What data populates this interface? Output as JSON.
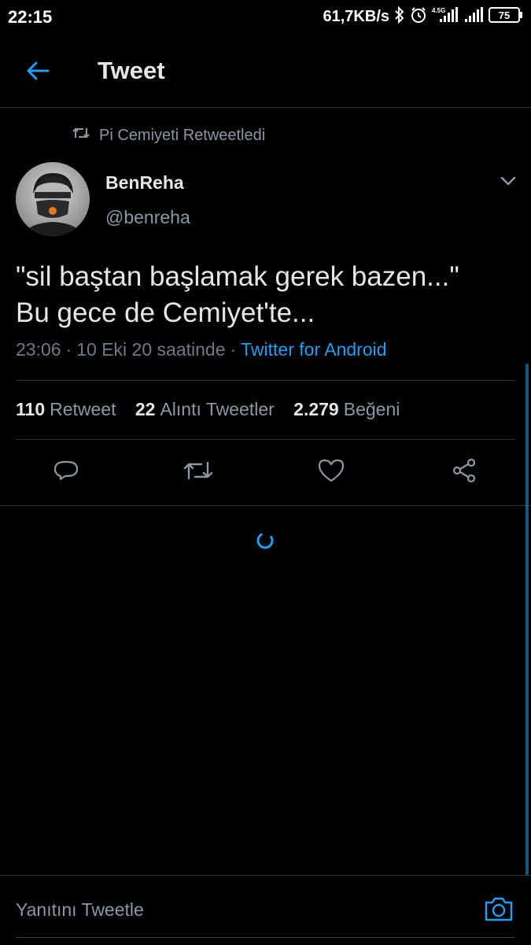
{
  "status_bar": {
    "time": "22:15",
    "net_speed": "61,7KB/s",
    "network_type": "4.5G",
    "battery": "75",
    "icons": [
      "bluetooth-icon",
      "alarm-icon",
      "signal-icon",
      "signal-icon",
      "battery-icon"
    ]
  },
  "header": {
    "title": "Tweet",
    "back_icon": "arrow-left-icon"
  },
  "retweet_context": {
    "text": "Pi Cemiyeti Retweetledi",
    "icon": "retweet-icon"
  },
  "author": {
    "name": "BenReha",
    "handle": "@benreha"
  },
  "tweet": {
    "text": "\"sil baştan başlamak gerek bazen...\"\nBu gece de Cemiyet'te...",
    "time": "23:06",
    "date": "10 Eki 20 saatinde",
    "separator": "·",
    "source": "Twitter for Android"
  },
  "stats": {
    "retweets": {
      "count": "110",
      "label": "Retweet"
    },
    "quotes": {
      "count": "22",
      "label": "Alıntı Tweetler"
    },
    "likes": {
      "count": "2.279",
      "label": "Beğeni"
    }
  },
  "actions": [
    "reply-icon",
    "retweet-icon",
    "like-icon",
    "share-icon"
  ],
  "reply": {
    "placeholder": "Yanıtını Tweetle",
    "camera_icon": "camera-icon"
  },
  "colors": {
    "background": "#000000",
    "accent": "#1DA1F2",
    "secondary_text": "#8B98A5",
    "divider": "#2F3336"
  }
}
